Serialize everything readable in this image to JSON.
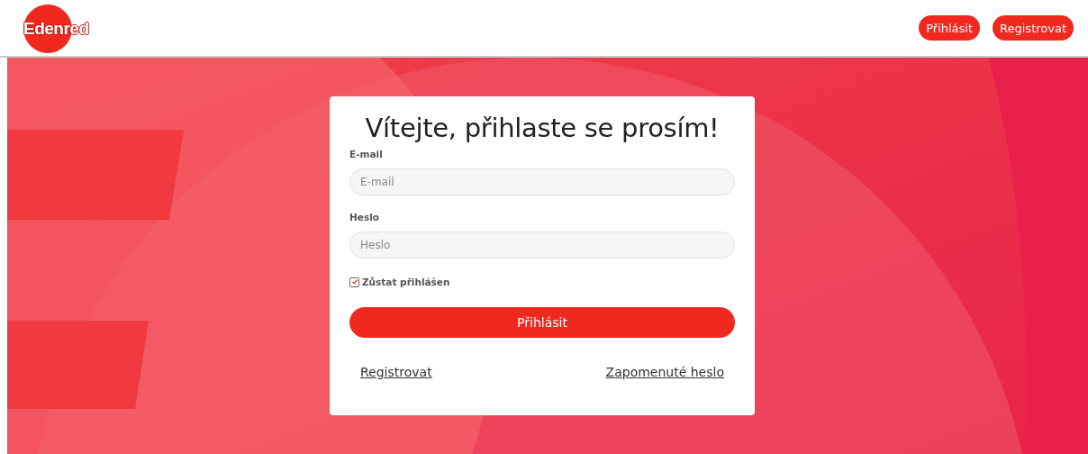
{
  "header": {
    "logo": "Edenred",
    "buttons": [
      "Přihlásit",
      "Registrovat"
    ]
  },
  "login": {
    "title": "Vítejte, přihlaste se prosím!",
    "fields": [
      {
        "label": "E-mail",
        "placeholder": "E-mail"
      },
      {
        "label": "Heslo",
        "placeholder": "Heslo"
      }
    ],
    "remember": {
      "label": "Zůstat přihlášen",
      "checked": true
    },
    "submit": "Přihlásit",
    "links": [
      "Registrovat",
      "Zapomenuté heslo"
    ]
  }
}
